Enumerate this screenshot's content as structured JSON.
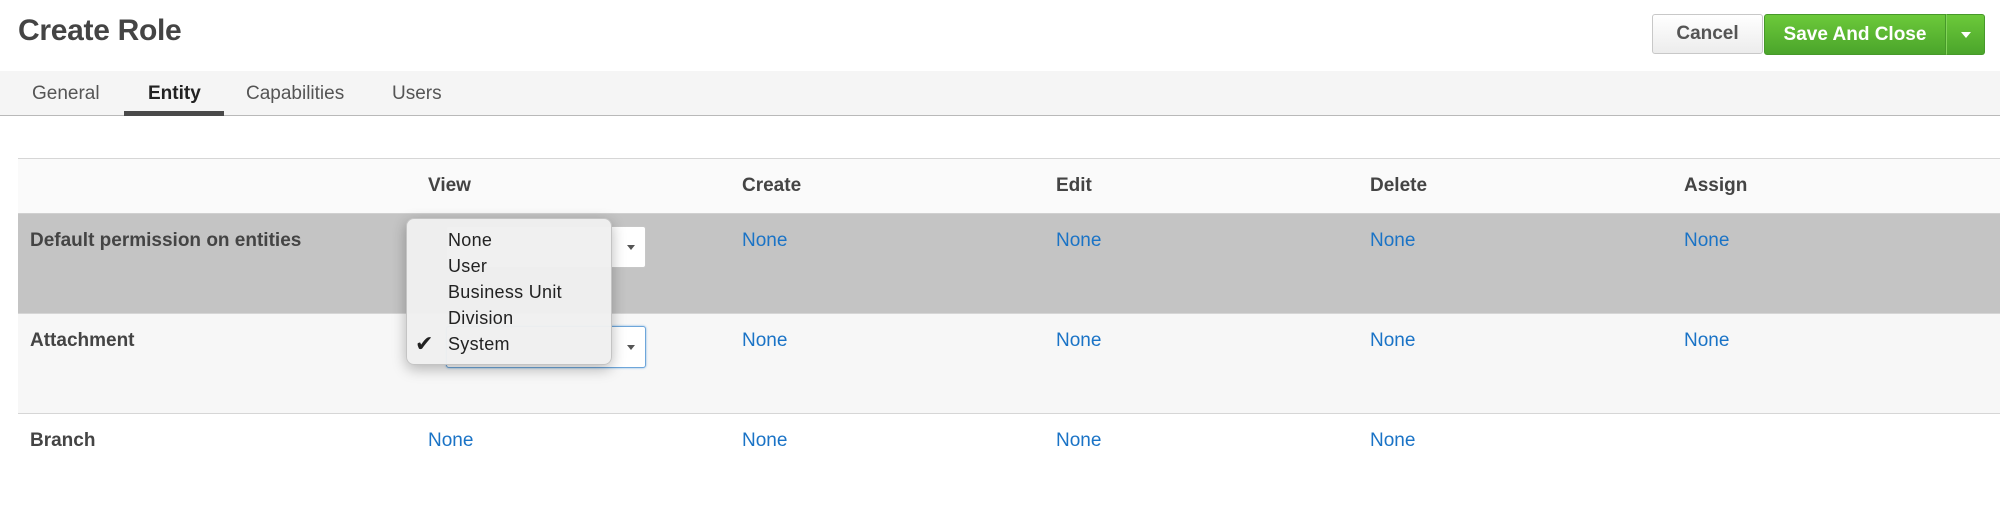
{
  "header": {
    "title": "Create Role",
    "cancel_label": "Cancel",
    "save_label": "Save And Close"
  },
  "tabs": [
    {
      "label": "General"
    },
    {
      "label": "Entity"
    },
    {
      "label": "Capabilities"
    },
    {
      "label": "Users"
    }
  ],
  "active_tab": "Entity",
  "table": {
    "columns": [
      "",
      "View",
      "Create",
      "Edit",
      "Delete",
      "Assign"
    ],
    "rows": [
      {
        "label": "Default permission on entities",
        "view": "",
        "create": "None",
        "edit": "None",
        "delete": "None",
        "assign": "None"
      },
      {
        "label": "Attachment",
        "view": "",
        "create": "None",
        "edit": "None",
        "delete": "None",
        "assign": "None"
      },
      {
        "label": "Branch",
        "view": "None",
        "create": "None",
        "edit": "None",
        "delete": "None",
        "assign": ""
      }
    ]
  },
  "dropdown": {
    "options": [
      "None",
      "User",
      "Business Unit",
      "Division",
      "System"
    ],
    "selected": "System",
    "check_glyph": "✔"
  },
  "colors": {
    "link": "#1a73c6",
    "save_button": "#5bb832",
    "highlight_row": "#c4c4c4"
  }
}
